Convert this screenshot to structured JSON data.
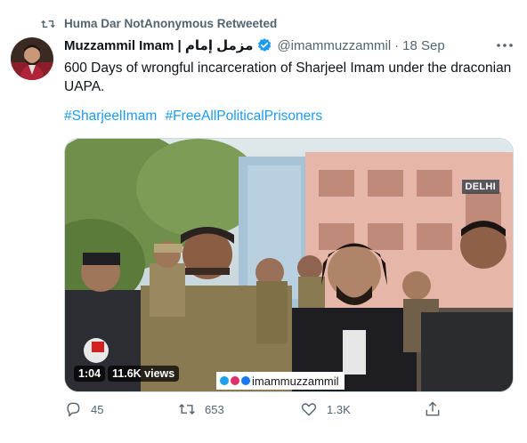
{
  "retweet": {
    "text": "Huma Dar NotAnonymous Retweeted"
  },
  "author": {
    "name": "Muzzammil Imam | مزمل إمام",
    "handle": "@imammuzzammil",
    "separator": "·",
    "time": "18 Sep"
  },
  "tweet": {
    "text": "600 Days of wrongful incarceration of Sharjeel Imam under the draconian UAPA.",
    "hashtags": [
      "#SharjeelImam",
      "#FreeAllPoliticalPrisoners"
    ]
  },
  "media": {
    "location_tag": "DELHI",
    "duration": "1:04",
    "views": "11.6K views",
    "watermark": "imammuzzammil"
  },
  "actions": {
    "replies": "45",
    "retweets": "653",
    "likes": "1.3K"
  },
  "colors": {
    "link": "#1d9bf0",
    "secondary": "#536471",
    "verified": "#1d9bf0"
  },
  "icons": [
    "retweet-icon",
    "verified-icon",
    "more-icon",
    "reply-icon",
    "like-icon",
    "share-icon"
  ]
}
